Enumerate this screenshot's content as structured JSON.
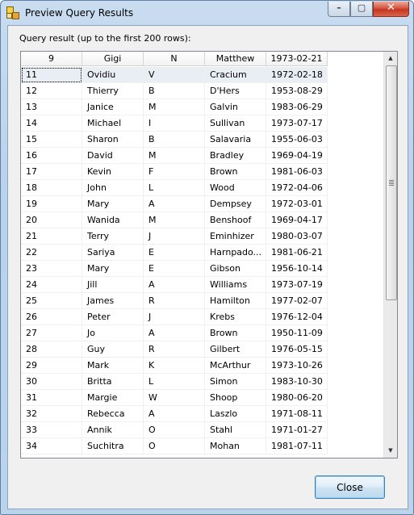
{
  "window": {
    "title": "Preview Query Results",
    "controls": {
      "minimize_icon": "minimize-icon",
      "maximize_icon": "maximize-icon",
      "close_icon": "close-icon"
    }
  },
  "caption": "Query result (up to the first 200 rows):",
  "grid": {
    "columns": [
      "9",
      "Gigi",
      "N",
      "Matthew",
      "1973-02-21"
    ],
    "rows": [
      [
        "11",
        "Ovidiu",
        "V",
        "Cracium",
        "1972-02-18"
      ],
      [
        "12",
        "Thierry",
        "B",
        "D'Hers",
        "1953-08-29"
      ],
      [
        "13",
        "Janice",
        "M",
        "Galvin",
        "1983-06-29"
      ],
      [
        "14",
        "Michael",
        "I",
        "Sullivan",
        "1973-07-17"
      ],
      [
        "15",
        "Sharon",
        "B",
        "Salavaria",
        "1955-06-03"
      ],
      [
        "16",
        "David",
        "M",
        "Bradley",
        "1969-04-19"
      ],
      [
        "17",
        "Kevin",
        "F",
        "Brown",
        "1981-06-03"
      ],
      [
        "18",
        "John",
        "L",
        "Wood",
        "1972-04-06"
      ],
      [
        "19",
        "Mary",
        "A",
        "Dempsey",
        "1972-03-01"
      ],
      [
        "20",
        "Wanida",
        "M",
        "Benshoof",
        "1969-04-17"
      ],
      [
        "21",
        "Terry",
        "J",
        "Eminhizer",
        "1980-03-07"
      ],
      [
        "22",
        "Sariya",
        "E",
        "Harnpado...",
        "1981-06-21"
      ],
      [
        "23",
        "Mary",
        "E",
        "Gibson",
        "1956-10-14"
      ],
      [
        "24",
        "Jill",
        "A",
        "Williams",
        "1973-07-19"
      ],
      [
        "25",
        "James",
        "R",
        "Hamilton",
        "1977-02-07"
      ],
      [
        "26",
        "Peter",
        "J",
        "Krebs",
        "1976-12-04"
      ],
      [
        "27",
        "Jo",
        "A",
        "Brown",
        "1950-11-09"
      ],
      [
        "28",
        "Guy",
        "R",
        "Gilbert",
        "1976-05-15"
      ],
      [
        "29",
        "Mark",
        "K",
        "McArthur",
        "1973-10-26"
      ],
      [
        "30",
        "Britta",
        "L",
        "Simon",
        "1983-10-30"
      ],
      [
        "31",
        "Margie",
        "W",
        "Shoop",
        "1980-06-20"
      ],
      [
        "32",
        "Rebecca",
        "A",
        "Laszlo",
        "1971-08-11"
      ],
      [
        "33",
        "Annik",
        "O",
        "Stahl",
        "1971-01-27"
      ],
      [
        "34",
        "Suchitra",
        "O",
        "Mohan",
        "1981-07-11"
      ]
    ],
    "selected_row": 0
  },
  "close_button": {
    "label": "Close"
  }
}
